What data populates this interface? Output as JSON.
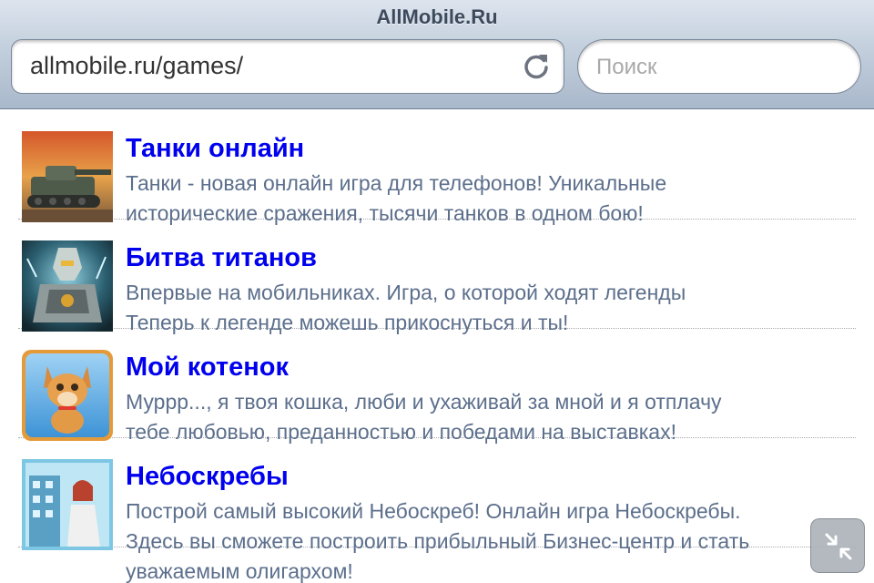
{
  "browser": {
    "title": "AllMobile.Ru",
    "url": "allmobile.ru/games/",
    "search_placeholder": "Поиск",
    "reload_icon": "reload-icon",
    "resize_icon": "exit-fullscreen-icon"
  },
  "games": [
    {
      "title": "Танки онлайн",
      "desc1": "Танки - новая онлайн игра для телефонов! Уникальные",
      "desc2": "исторические сражения, тысячи танков в одном бою!",
      "icon": "tank-game-thumbnail"
    },
    {
      "title": "Битва титанов",
      "desc1": "Впервые на мобильниках. Игра, о которой ходят легенды",
      "desc2": "Теперь к легенде можешь прикоснуться и ты!",
      "icon": "titan-game-thumbnail"
    },
    {
      "title": "Мой котенок",
      "desc1": "Муррр..., я твоя кошка, люби и ухаживай за мной и я отплачу",
      "desc2": "тебе любовью, преданностью и победами на выставках!",
      "icon": "kitten-game-thumbnail"
    },
    {
      "title": "Небоскребы",
      "desc1": "Построй самый высокий Небоскреб! Онлайн игра Небоскребы.",
      "desc2": "Здесь вы сможете построить прибыльный Бизнес-центр и стать",
      "desc3": "уважаемым олигархом!",
      "icon": "skyscraper-game-thumbnail"
    }
  ],
  "colors": {
    "link": "#0000ee",
    "description": "#5c6f8c",
    "toolbar": "#c3cfdd"
  }
}
